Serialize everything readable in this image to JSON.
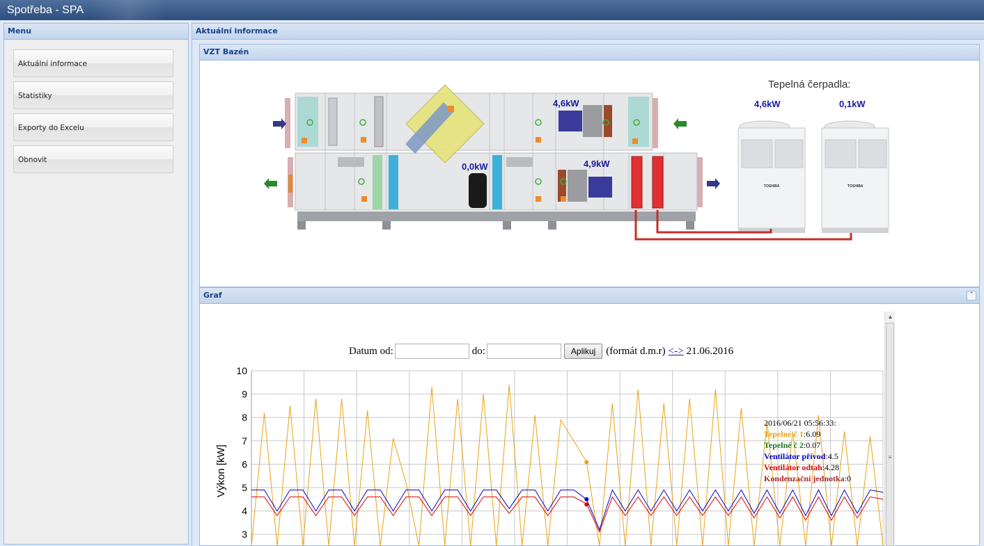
{
  "app": {
    "title": "Spotřeba - SPA"
  },
  "menu": {
    "title": "Menu",
    "items": [
      {
        "label": "Aktuální informace"
      },
      {
        "label": "Statistiky"
      },
      {
        "label": "Exporty do Excelu"
      },
      {
        "label": "Obnovit"
      }
    ]
  },
  "main": {
    "title": "Aktuální informace",
    "vzt": {
      "title": "VZT Bazén",
      "heat_pumps_title": "Tepelná čerpadla:",
      "readings": {
        "fan_supply": "4,6kW",
        "fan_exhaust": "4,9kW",
        "condensing": "0,0kW",
        "hp1": "4,6kW",
        "hp2": "0,1kW"
      },
      "colors": {
        "unit_body": "#e3e4e6",
        "pipe": "#c0302a",
        "heater": "#e03030",
        "fan_motor": "#3a3a9a"
      }
    },
    "graf": {
      "title": "Graf",
      "form": {
        "from_label": "Datum od:",
        "from_value": "",
        "to_label": "do:",
        "to_value": "",
        "apply_label": "Aplikuj",
        "format_label": "(formát d.m.r)",
        "nav_link": "<->",
        "current_date": "21.06.2016"
      },
      "tooltip": {
        "timestamp": "2016/06/21 05:56:33:",
        "rows": [
          {
            "name": "Tepelné č 1",
            "value": "6.09",
            "color": "#e8a317"
          },
          {
            "name": "Tepelné č 2",
            "value": "0.07",
            "color": "#1d7a1d"
          },
          {
            "name": "Ventilátor přívod",
            "value": "4.5",
            "color": "#0000cc"
          },
          {
            "name": "Ventilátor odtah",
            "value": "4.28",
            "color": "#dd0000"
          },
          {
            "name": "Kondenzační jednotka",
            "value": "0",
            "color": "#a52a2a"
          }
        ]
      }
    }
  },
  "chart_data": {
    "type": "line",
    "ylabel": "Výkon [kW]",
    "xlabel": "",
    "ylim": [
      2.5,
      10
    ],
    "yticks": [
      3,
      4,
      5,
      6,
      7,
      8,
      9,
      10
    ],
    "grid": true,
    "series": [
      {
        "name": "Tepelné č 1",
        "color": "#e8a317",
        "values": [
          2.5,
          8.2,
          2.5,
          8.5,
          2.5,
          8.8,
          2.5,
          8.8,
          2.5,
          8.3,
          2.5,
          7.1,
          5.2,
          2.5,
          9.3,
          2.5,
          8.8,
          2.5,
          9.0,
          2.5,
          9.4,
          2.5,
          8.1,
          2.5,
          7.9,
          7.0,
          6.1,
          2.5,
          8.6,
          2.5,
          9.2,
          2.5,
          8.6,
          2.5,
          8.8,
          2.5,
          9.2,
          2.5,
          8.4,
          2.5,
          7.8,
          2.5,
          7.4,
          2.5,
          8.1,
          2.5,
          7.4,
          2.5,
          7.2,
          2.5
        ]
      },
      {
        "name": "Ventilátor přívod",
        "color": "#0000cc",
        "values": [
          4.9,
          4.9,
          4.0,
          4.9,
          4.9,
          4.0,
          4.9,
          4.9,
          4.0,
          4.9,
          4.9,
          4.0,
          4.9,
          4.9,
          4.0,
          4.9,
          4.9,
          4.0,
          4.9,
          4.9,
          4.1,
          4.9,
          4.9,
          4.0,
          4.9,
          4.9,
          4.5,
          3.2,
          4.9,
          4.0,
          4.9,
          4.0,
          4.9,
          4.0,
          4.9,
          4.0,
          4.9,
          4.0,
          4.9,
          3.9,
          4.9,
          3.9,
          4.9,
          3.8,
          4.9,
          3.8,
          4.9,
          3.9,
          4.9,
          4.8
        ]
      },
      {
        "name": "Ventilátor odtah",
        "color": "#dd0000",
        "values": [
          4.6,
          4.6,
          3.8,
          4.6,
          4.6,
          3.8,
          4.6,
          4.6,
          3.8,
          4.6,
          4.6,
          3.8,
          4.6,
          4.6,
          3.8,
          4.6,
          4.6,
          3.8,
          4.6,
          4.6,
          3.9,
          4.6,
          4.6,
          3.8,
          4.6,
          4.6,
          4.3,
          3.1,
          4.6,
          3.8,
          4.6,
          3.8,
          4.6,
          3.8,
          4.6,
          3.8,
          4.6,
          3.8,
          4.6,
          3.7,
          4.6,
          3.7,
          4.6,
          3.6,
          4.6,
          3.6,
          4.6,
          3.7,
          4.6,
          4.5
        ]
      }
    ],
    "highlight": {
      "index": 26,
      "values": {
        "Tepelné č 1": 6.09,
        "Ventilátor přívod": 4.5,
        "Ventilátor odtah": 4.28
      }
    }
  }
}
